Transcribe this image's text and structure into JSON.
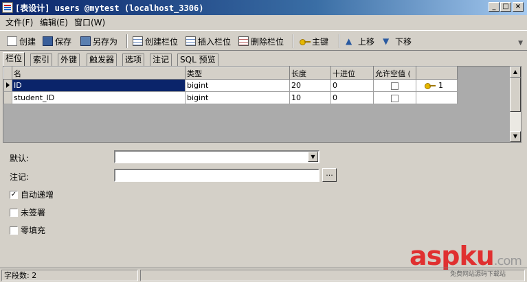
{
  "window": {
    "title": "[表设计] users @mytest (localhost_3306)",
    "buttons": {
      "minimize": "_",
      "maximize": "□",
      "close": "×"
    }
  },
  "menu": [
    {
      "label": "文件(F)"
    },
    {
      "label": "编辑(E)"
    },
    {
      "label": "窗口(W)"
    }
  ],
  "toolbar": {
    "create": "创建",
    "save": "保存",
    "save_as": "另存为",
    "add_field": "创建栏位",
    "insert_field": "插入栏位",
    "delete_field": "删除栏位",
    "primary_key": "主键",
    "move_up": "上移",
    "move_down": "下移"
  },
  "tabs": [
    "栏位",
    "索引",
    "外键",
    "触发器",
    "选项",
    "注记",
    "SQL 预览"
  ],
  "grid": {
    "columns": [
      "名",
      "类型",
      "长度",
      "十进位",
      "允许空值 (",
      ""
    ],
    "rows": [
      {
        "name": "ID",
        "type": "bigint",
        "length": "20",
        "decimals": "0",
        "nullable": false,
        "key_rank": "1"
      },
      {
        "name": "student_ID",
        "type": "bigint",
        "length": "10",
        "decimals": "0",
        "nullable": false,
        "key_rank": ""
      }
    ]
  },
  "props": {
    "default_label": "默认:",
    "default_value": "",
    "comment_label": "注记:",
    "comment_value": "",
    "ellipsis": "...",
    "auto_increment_label": "自动递增",
    "auto_increment": true,
    "unsigned_label": "未签署",
    "unsigned": false,
    "zerofill_label": "零填充",
    "zerofill": false
  },
  "status": {
    "field_count": "字段数: 2"
  },
  "watermark": {
    "brand": "aspku",
    "suffix": ".com",
    "tagline": "免费网站源码下载站"
  },
  "colors": {
    "selection": "#0a246a",
    "title_bar": "#0a246a",
    "watermark": "#e03030"
  }
}
